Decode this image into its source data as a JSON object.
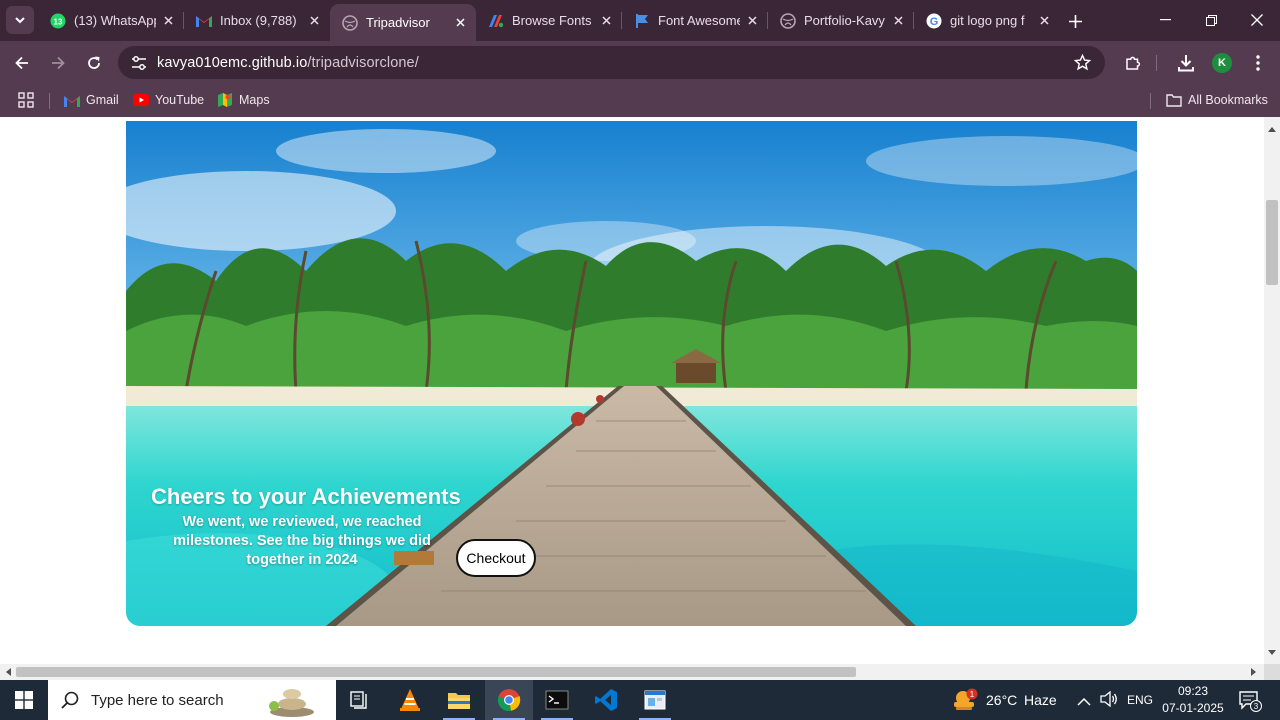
{
  "browser": {
    "tabs": [
      {
        "title": "(13) WhatsApp",
        "icon": "whatsapp-icon",
        "badge": "13",
        "active": false
      },
      {
        "title": "Inbox (9,788)",
        "icon": "gmail-icon",
        "active": false
      },
      {
        "title": "Tripadvisor",
        "icon": "globe-icon",
        "active": true
      },
      {
        "title": "Browse Fonts",
        "icon": "google-fonts-icon",
        "active": false
      },
      {
        "title": "Font Awesome",
        "icon": "font-awesome-flag-icon",
        "active": false
      },
      {
        "title": "Portfolio-Kavy",
        "icon": "globe-icon",
        "active": false
      },
      {
        "title": "git logo png f",
        "icon": "google-icon",
        "active": false
      }
    ],
    "url_host": "kavya010emc.github.io",
    "url_path": "/tripadvisorclone/",
    "profile_initial": "K",
    "bookmarks": [
      {
        "label": "Gmail",
        "icon": "gmail-icon"
      },
      {
        "label": "YouTube",
        "icon": "youtube-icon"
      },
      {
        "label": "Maps",
        "icon": "maps-icon"
      }
    ],
    "all_bookmarks_label": "All Bookmarks"
  },
  "hero": {
    "title": "Cheers to your Achievements",
    "subtitle": "We went, we reviewed, we reached milestones. See the big things we did together in 2024",
    "button_label": "Checkout",
    "image_description": "tropical beach pier"
  },
  "taskbar": {
    "search_placeholder": "Type here to search",
    "weather_temp": "26°C",
    "weather_text": "Haze",
    "weather_badge": "1",
    "language": "ENG",
    "time": "09:23",
    "date": "07-01-2025",
    "notification_count": "3"
  },
  "colors": {
    "tabbar_bg": "#3b2637",
    "toolbar_bg": "#553b50",
    "taskbar_bg": "#1f2a38",
    "sea": "#2ad4cf",
    "sky": "#1e8fd6"
  }
}
